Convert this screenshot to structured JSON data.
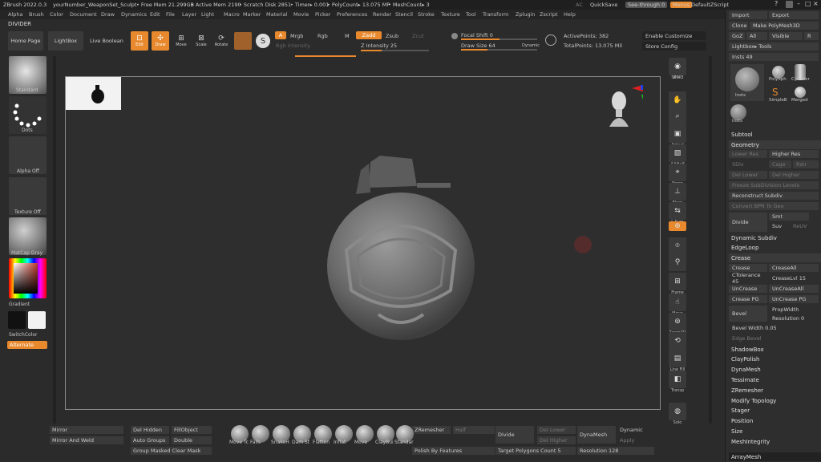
{
  "titlebar": {
    "app": "ZBrush 2022.0.3",
    "doc": "yourNumber_WeaponSet_Sculpt",
    "free_mem": "• Free Mem 21.299GB",
    "active_mem": "• Active Mem 2190",
    "scratch": "• Scratch Disk 2851",
    "timer": "• Timer▸ 0.001",
    "polycount": "• PolyCount▸ 13.075 MP",
    "meshcount": "• MeshCount▸ 3",
    "ac": "AC",
    "quicksave": "QuickSave",
    "seethrough": "See-through  0",
    "menus": "Menus",
    "script": "DefaultZScript"
  },
  "menu": [
    "Alpha",
    "Brush",
    "Color",
    "Document",
    "Draw",
    "Dynamics",
    "Edit",
    "File",
    "Layer",
    "Light",
    "Macro",
    "Marker",
    "Material",
    "Movie",
    "Picker",
    "Preferences",
    "Render",
    "Stencil",
    "Stroke",
    "Texture",
    "Tool",
    "Transform",
    "Zplugin",
    "Zscript",
    "Help"
  ],
  "divider": "DIVIDER",
  "toolbar": {
    "home": "Home Page",
    "lightbox": "LightBox",
    "live_boolean": "Live Boolean",
    "edit": "Edit",
    "draw": "Draw",
    "move": "Move",
    "scale": "Scale",
    "rotate": "Rotate",
    "a": "A",
    "mrgb": "Mrgb",
    "rgb": "Rgb",
    "m": "M",
    "zadd": "Zadd",
    "zsub": "Zsub",
    "zcut": "Zcut",
    "rgb_intensity": "Rgb Intensity",
    "z_intensity": "Z Intensity 25",
    "focal_shift": "Focal Shift 0",
    "draw_size": "Draw Size 64",
    "dynamic": "Dynamic",
    "active_points": "ActivePoints: 382",
    "total_points": "TotalPoints: 13.075 Mil",
    "enable_customize": "Enable Customize",
    "store_config": "Store Config"
  },
  "left_shelf": {
    "standard": "Standard",
    "dots": "Dots",
    "alpha_off": "Alpha Off",
    "texture_off": "Texture Off",
    "matcap": "MatCap Gray",
    "gradient": "Gradient",
    "switchcolor": "SwitchColor",
    "alternate": "Alternate"
  },
  "right_shelf": [
    "BPR",
    "SPix 3",
    "Scroll",
    "Zoom",
    "Actual",
    "AAHalf",
    "Persp",
    "Floor",
    "L.Sym",
    "Gxyz",
    "",
    "",
    "Frame",
    "Move",
    "Zoom3D",
    "Rotate",
    "Line Fill PolyF",
    "Transp",
    "",
    "Solo",
    "Xpose 0"
  ],
  "tray": {
    "import": "Import",
    "export": "Export",
    "clone": "Clone",
    "make_polymesh": "Make PolyMesh3D",
    "goz": "GoZ",
    "all": "All",
    "visible": "Visible",
    "r": "R",
    "lightbox_tools": "Lightbox▸ Tools",
    "insts": "Insts 49",
    "tool_labels": [
      "Insts",
      "PolySph",
      "Cylinder",
      "SimpleB",
      "Merged",
      "Insts"
    ],
    "subtool": "Subtool",
    "geometry": "Geometry",
    "lower_res": "Lower Res",
    "higher_res": "Higher Res",
    "sdiv": "SDiv",
    "cage": "Cage",
    "rstr": "Rstr",
    "del_lower": "Del Lower",
    "del_higher": "Del Higher",
    "freeze": "Freeze SubDivision Levels",
    "reconstruct": "Reconstruct Subdiv",
    "convert_bpr": "Convert BPR To Geo",
    "divide": "Divide",
    "smt": "Smt",
    "suv": "Suv",
    "reuv": "ReUV",
    "dynamic_subdiv": "Dynamic Subdiv",
    "edgeloop": "EdgeLoop",
    "crease_head": "Crease",
    "crease": "Crease",
    "crease_all": "CreaseAll",
    "ctolerance": "CTolerance 45",
    "creaselvl": "CreaseLvl 15",
    "uncrease": "UnCrease",
    "uncrease_all": "UnCreaseAll",
    "crease_pg": "Crease PG",
    "uncrease_pg": "UnCrease PG",
    "bevel": "Bevel",
    "propwidth": "PropWidth",
    "resolution": "Resolution 0",
    "bevel_width": "Bevel Width 0.05",
    "edge_bevel": "Edge Bevel",
    "list": [
      "ShadowBox",
      "ClayPolish",
      "DynaMesh",
      "Tessimate",
      "ZRemesher",
      "Modify Topology",
      "Stager",
      "Position",
      "Size",
      "MeshIntegrity"
    ],
    "arraymesh": "ArrayMesh"
  },
  "bottom": {
    "mirror": "Mirror",
    "mirror_weld": "Mirror And Weld",
    "del_hidden": "Del Hidden",
    "fill_object": "FillObject",
    "auto_groups": "Auto Groups",
    "double": "Double",
    "group_masked": "Group Masked Clear Mask",
    "brushes": [
      "Move Tc",
      "Falls",
      "SnakeH",
      "Dam St",
      "Flatten",
      "Inflat",
      "Move",
      "ClayBui",
      "Standar"
    ],
    "zremesher": "ZRemesher",
    "half": "Half",
    "polish_features": "Polish By Features",
    "target_polygons": "Target Polygons Count 5",
    "divide": "Divide",
    "del_lower": "Del Lower",
    "del_higher": "Del Higher",
    "dynamesh": "DynaMesh",
    "resolution": "Resolution 128",
    "dynamic": "Dynamic",
    "apply": "Apply"
  }
}
